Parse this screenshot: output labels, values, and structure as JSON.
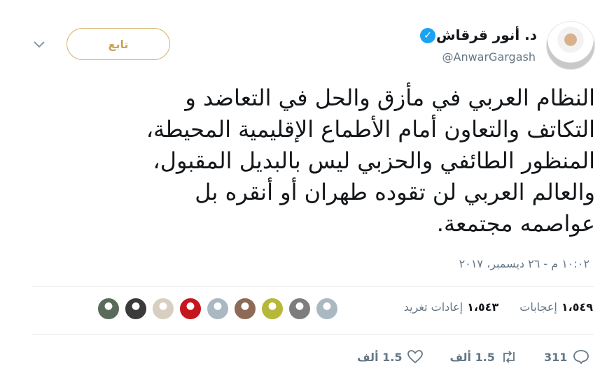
{
  "header": {
    "display_name": "د. أنور قرقاش",
    "handle": "@AnwarGargash",
    "follow_label": "تابع"
  },
  "tweet": {
    "lines": [
      "النظام العربي في مأزق والحل في التعاضد و",
      "التكاتف والتعاون أمام الأطماع الإقليمية المحيطة،",
      "المنظور الطائفي والحزبي ليس بالبديل المقبول،",
      "والعالم العربي لن تقوده طهران أو أنقره بل",
      "عواصمه مجتمعة."
    ],
    "timestamp": "١٠:٠٢ م - ٢٦ ديسمبر، ٢٠١٧"
  },
  "stats": {
    "retweets_count": "١،٥٤٣",
    "retweets_label": "إعادات تغريد",
    "likes_count": "١،٥٤٩",
    "likes_label": "إعجابات"
  },
  "faces": [
    {
      "icon": "default-avatar-icon",
      "color": "#aab8c2"
    },
    {
      "icon": "user-avatar",
      "color": "#7d7d7d"
    },
    {
      "icon": "user-avatar",
      "color": "#b7b83a"
    },
    {
      "icon": "user-avatar",
      "color": "#8c6a55"
    },
    {
      "icon": "default-avatar-icon",
      "color": "#aab8c2"
    },
    {
      "icon": "club-logo-avatar",
      "color": "#c4161c"
    },
    {
      "icon": "user-avatar",
      "color": "#d8cfc0"
    },
    {
      "icon": "user-avatar",
      "color": "#3a3a3a"
    },
    {
      "icon": "user-avatar",
      "color": "#5a6b5a"
    }
  ],
  "actions": {
    "reply_count": "311",
    "retweet_count": "1.5 ألف",
    "like_count": "1.5 ألف"
  },
  "colors": {
    "accent_gold": "#c7a45a",
    "verified_blue": "#1da1f2",
    "muted": "#657786"
  }
}
